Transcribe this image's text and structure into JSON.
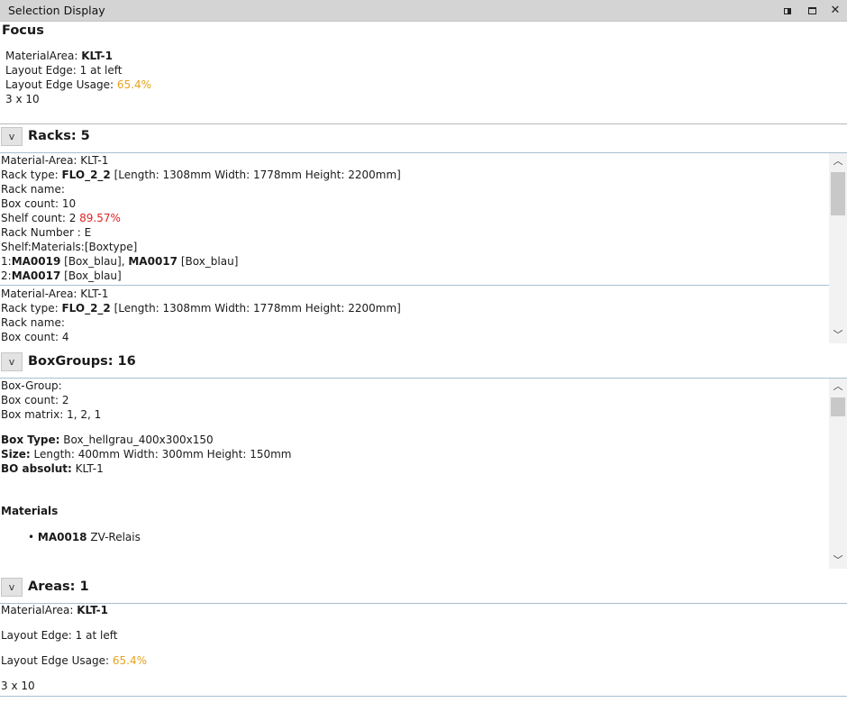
{
  "window": {
    "title": "Selection Display",
    "icons": {
      "detach": "detach-icon",
      "maximize": "maximize-icon",
      "close": "close-icon"
    },
    "close_glyph": "✕"
  },
  "focus": {
    "title": "Focus",
    "material_area_label": "MaterialArea: ",
    "material_area_value": "KLT-1",
    "layout_edge": "Layout Edge: 1 at left",
    "usage_label": "Layout Edge Usage: ",
    "usage_value": "65.4%",
    "matrix": "3 x 10"
  },
  "racks": {
    "toggle": "v",
    "title": "Racks: 5",
    "items": [
      {
        "material_area": "Material-Area: KLT-1",
        "type_label": "Rack type: ",
        "type_value": "FLO_2_2",
        "dims": " [Length: 1308mm Width: 1778mm Height: 2200mm]",
        "name": "Rack name:",
        "box_count": "Box count: 10",
        "shelf_label": "Shelf count: 2 ",
        "shelf_pct": "89.57%",
        "rack_number": "Rack Number : E",
        "shelf_materials": "Shelf:Materials:[Boxtype]",
        "row1_idx": "1:",
        "row1_m1": "MA0019",
        "row1_b1": " [Box_blau], ",
        "row1_m2": "MA0017",
        "row1_b2": " [Box_blau]",
        "row2_idx": "2:",
        "row2_m1": "MA0017",
        "row2_b1": " [Box_blau]"
      },
      {
        "material_area": "Material-Area: KLT-1",
        "type_label": "Rack type: ",
        "type_value": "FLO_2_2",
        "dims": " [Length: 1308mm Width: 1778mm Height: 2200mm]",
        "name": "Rack name:",
        "box_count": "Box count: 4"
      }
    ]
  },
  "boxgroups": {
    "toggle": "v",
    "title": "BoxGroups: 16",
    "group": "Box-Group:",
    "box_count": "Box count: 2",
    "box_matrix": "Box matrix: 1, 2, 1",
    "box_type_label": "Box Type:",
    "box_type_value": "  Box_hellgrau_400x300x150",
    "size_label": "Size:",
    "size_value": "  Length: 400mm Width: 300mm Height: 150mm",
    "bo_label": "BO absolut:",
    "bo_value": "  KLT-1",
    "materials_title": "Materials",
    "materials": [
      {
        "id": "MA0018",
        "name": " ZV-Relais"
      }
    ]
  },
  "areas": {
    "toggle": "v",
    "title": "Areas: 1",
    "material_area_label": "MaterialArea: ",
    "material_area_value": "KLT-1",
    "layout_edge": "Layout Edge: 1 at left",
    "usage_label": "Layout Edge Usage: ",
    "usage_value": "65.4%",
    "matrix": "3 x 10"
  },
  "scroll": {
    "up": "︿",
    "down": "﹀"
  }
}
